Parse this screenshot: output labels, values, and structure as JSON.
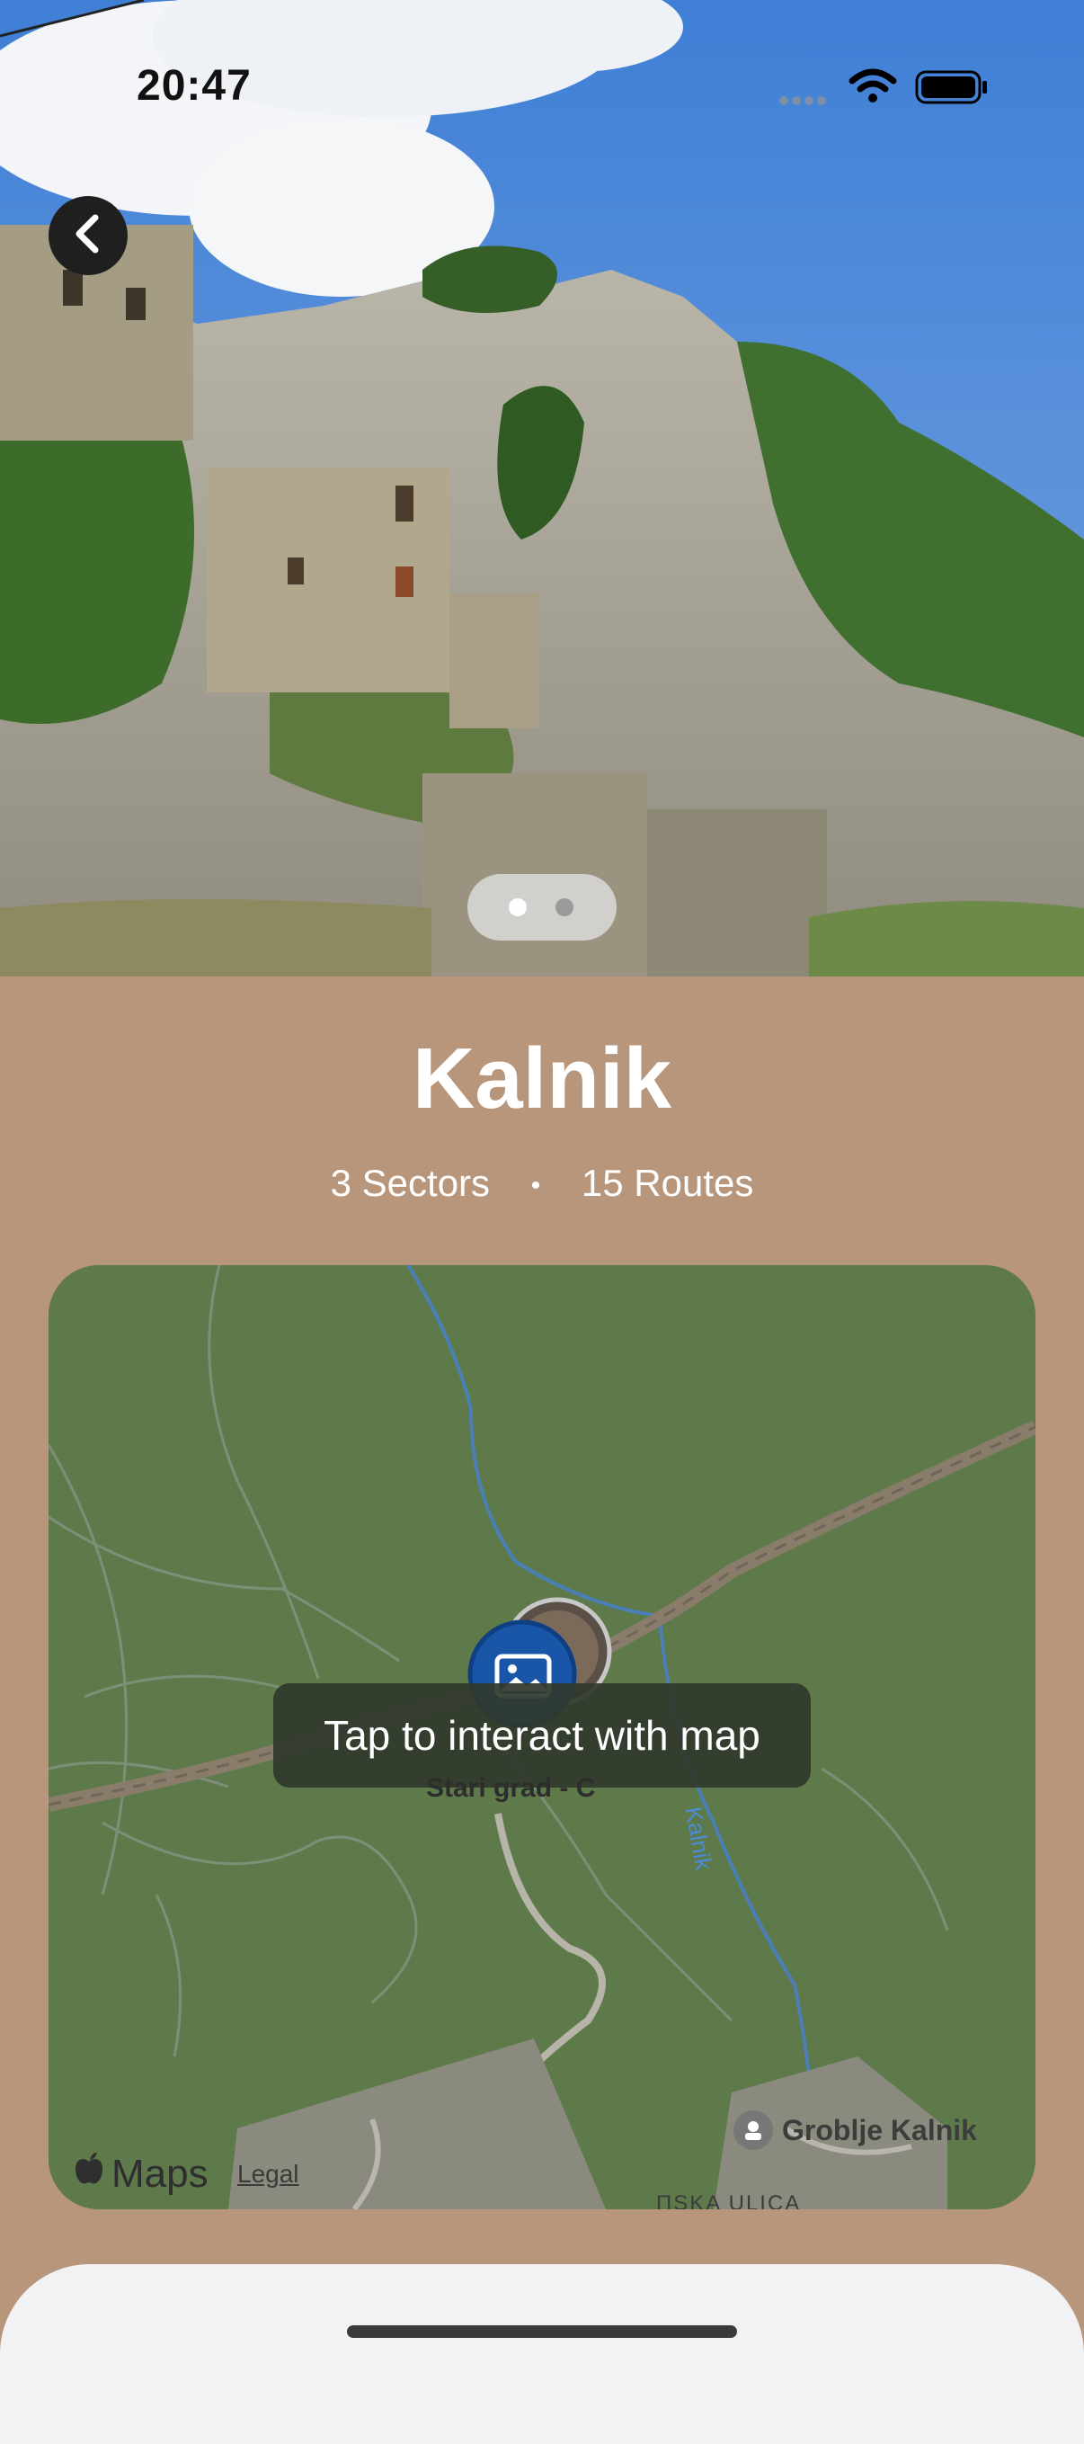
{
  "status_bar": {
    "time": "20:47"
  },
  "header": {
    "title": "Kalnik",
    "sectors": "3 Sectors",
    "separator": "•",
    "routes": "15 Routes"
  },
  "carousel": {
    "current_page": 1,
    "page_count": 2
  },
  "map": {
    "overlay_hint": "Tap to interact with map",
    "pin_label": "Stari grad - C",
    "river_label": "Kalnik",
    "poi_label": "Groblje Kalnik",
    "street_label": "ПSKA ULICA",
    "brand": "Maps",
    "legal": "Legal"
  },
  "colors": {
    "background": "#b8967b",
    "map_green": "#5e7a4b",
    "pin_blue": "#1a56a8"
  }
}
